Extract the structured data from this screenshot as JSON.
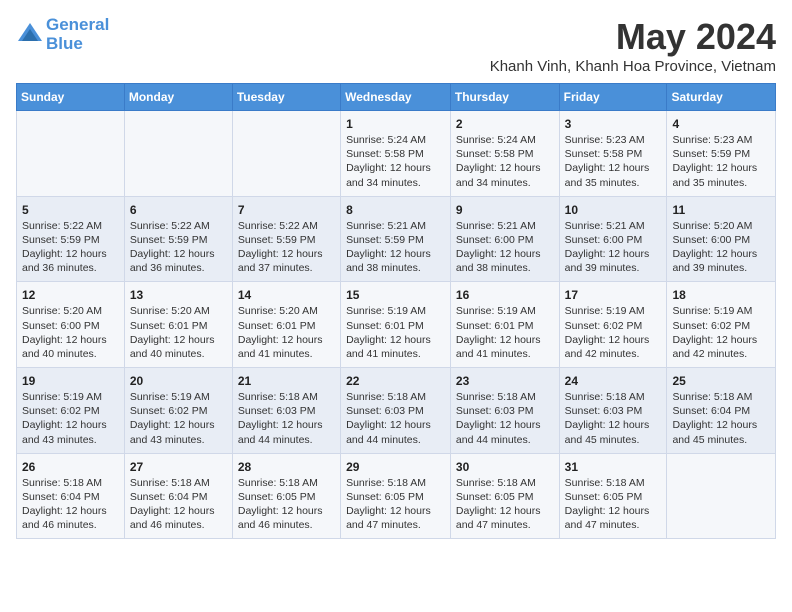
{
  "header": {
    "logo_line1": "General",
    "logo_line2": "Blue",
    "month_title": "May 2024",
    "location": "Khanh Vinh, Khanh Hoa Province, Vietnam"
  },
  "columns": [
    "Sunday",
    "Monday",
    "Tuesday",
    "Wednesday",
    "Thursday",
    "Friday",
    "Saturday"
  ],
  "weeks": [
    [
      {
        "day": "",
        "info": ""
      },
      {
        "day": "",
        "info": ""
      },
      {
        "day": "",
        "info": ""
      },
      {
        "day": "1",
        "info": "Sunrise: 5:24 AM\nSunset: 5:58 PM\nDaylight: 12 hours\nand 34 minutes."
      },
      {
        "day": "2",
        "info": "Sunrise: 5:24 AM\nSunset: 5:58 PM\nDaylight: 12 hours\nand 34 minutes."
      },
      {
        "day": "3",
        "info": "Sunrise: 5:23 AM\nSunset: 5:58 PM\nDaylight: 12 hours\nand 35 minutes."
      },
      {
        "day": "4",
        "info": "Sunrise: 5:23 AM\nSunset: 5:59 PM\nDaylight: 12 hours\nand 35 minutes."
      }
    ],
    [
      {
        "day": "5",
        "info": "Sunrise: 5:22 AM\nSunset: 5:59 PM\nDaylight: 12 hours\nand 36 minutes."
      },
      {
        "day": "6",
        "info": "Sunrise: 5:22 AM\nSunset: 5:59 PM\nDaylight: 12 hours\nand 36 minutes."
      },
      {
        "day": "7",
        "info": "Sunrise: 5:22 AM\nSunset: 5:59 PM\nDaylight: 12 hours\nand 37 minutes."
      },
      {
        "day": "8",
        "info": "Sunrise: 5:21 AM\nSunset: 5:59 PM\nDaylight: 12 hours\nand 38 minutes."
      },
      {
        "day": "9",
        "info": "Sunrise: 5:21 AM\nSunset: 6:00 PM\nDaylight: 12 hours\nand 38 minutes."
      },
      {
        "day": "10",
        "info": "Sunrise: 5:21 AM\nSunset: 6:00 PM\nDaylight: 12 hours\nand 39 minutes."
      },
      {
        "day": "11",
        "info": "Sunrise: 5:20 AM\nSunset: 6:00 PM\nDaylight: 12 hours\nand 39 minutes."
      }
    ],
    [
      {
        "day": "12",
        "info": "Sunrise: 5:20 AM\nSunset: 6:00 PM\nDaylight: 12 hours\nand 40 minutes."
      },
      {
        "day": "13",
        "info": "Sunrise: 5:20 AM\nSunset: 6:01 PM\nDaylight: 12 hours\nand 40 minutes."
      },
      {
        "day": "14",
        "info": "Sunrise: 5:20 AM\nSunset: 6:01 PM\nDaylight: 12 hours\nand 41 minutes."
      },
      {
        "day": "15",
        "info": "Sunrise: 5:19 AM\nSunset: 6:01 PM\nDaylight: 12 hours\nand 41 minutes."
      },
      {
        "day": "16",
        "info": "Sunrise: 5:19 AM\nSunset: 6:01 PM\nDaylight: 12 hours\nand 41 minutes."
      },
      {
        "day": "17",
        "info": "Sunrise: 5:19 AM\nSunset: 6:02 PM\nDaylight: 12 hours\nand 42 minutes."
      },
      {
        "day": "18",
        "info": "Sunrise: 5:19 AM\nSunset: 6:02 PM\nDaylight: 12 hours\nand 42 minutes."
      }
    ],
    [
      {
        "day": "19",
        "info": "Sunrise: 5:19 AM\nSunset: 6:02 PM\nDaylight: 12 hours\nand 43 minutes."
      },
      {
        "day": "20",
        "info": "Sunrise: 5:19 AM\nSunset: 6:02 PM\nDaylight: 12 hours\nand 43 minutes."
      },
      {
        "day": "21",
        "info": "Sunrise: 5:18 AM\nSunset: 6:03 PM\nDaylight: 12 hours\nand 44 minutes."
      },
      {
        "day": "22",
        "info": "Sunrise: 5:18 AM\nSunset: 6:03 PM\nDaylight: 12 hours\nand 44 minutes."
      },
      {
        "day": "23",
        "info": "Sunrise: 5:18 AM\nSunset: 6:03 PM\nDaylight: 12 hours\nand 44 minutes."
      },
      {
        "day": "24",
        "info": "Sunrise: 5:18 AM\nSunset: 6:03 PM\nDaylight: 12 hours\nand 45 minutes."
      },
      {
        "day": "25",
        "info": "Sunrise: 5:18 AM\nSunset: 6:04 PM\nDaylight: 12 hours\nand 45 minutes."
      }
    ],
    [
      {
        "day": "26",
        "info": "Sunrise: 5:18 AM\nSunset: 6:04 PM\nDaylight: 12 hours\nand 46 minutes."
      },
      {
        "day": "27",
        "info": "Sunrise: 5:18 AM\nSunset: 6:04 PM\nDaylight: 12 hours\nand 46 minutes."
      },
      {
        "day": "28",
        "info": "Sunrise: 5:18 AM\nSunset: 6:05 PM\nDaylight: 12 hours\nand 46 minutes."
      },
      {
        "day": "29",
        "info": "Sunrise: 5:18 AM\nSunset: 6:05 PM\nDaylight: 12 hours\nand 47 minutes."
      },
      {
        "day": "30",
        "info": "Sunrise: 5:18 AM\nSunset: 6:05 PM\nDaylight: 12 hours\nand 47 minutes."
      },
      {
        "day": "31",
        "info": "Sunrise: 5:18 AM\nSunset: 6:05 PM\nDaylight: 12 hours\nand 47 minutes."
      },
      {
        "day": "",
        "info": ""
      }
    ]
  ]
}
